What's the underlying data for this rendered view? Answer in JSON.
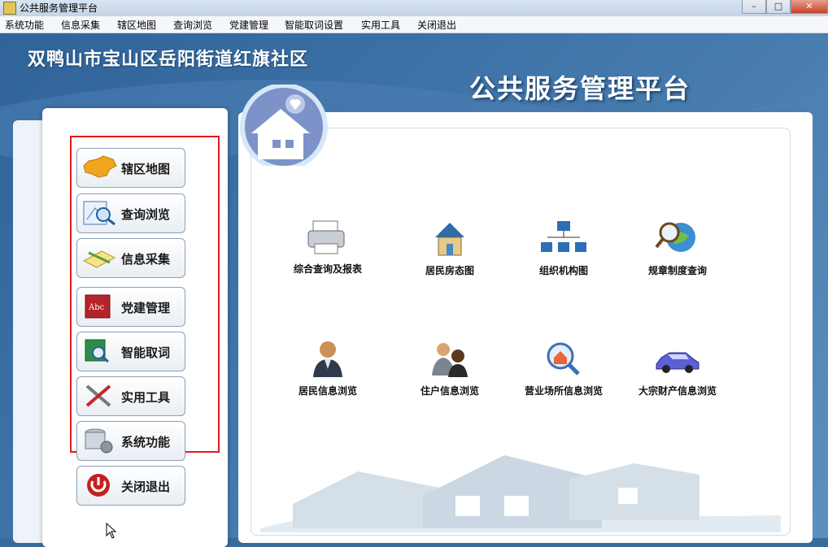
{
  "window": {
    "title": "公共服务管理平台",
    "buttons": [
      "–",
      "□",
      "✕"
    ]
  },
  "menu": [
    "系统功能",
    "信息采集",
    "辖区地图",
    "查询浏览",
    "党建管理",
    "智能取词设置",
    "实用工具",
    "关闭退出"
  ],
  "header": {
    "org_name": "双鸭山市宝山区岳阳街道红旗社区",
    "platform_title": "公共服务管理平台"
  },
  "sidebar": {
    "items": [
      {
        "label": "辖区地图",
        "icon": "china-map-icon"
      },
      {
        "label": "查询浏览",
        "icon": "magnifier-map-icon"
      },
      {
        "label": "信息采集",
        "icon": "notebook-pencil-icon"
      },
      {
        "label": "党建管理",
        "icon": "abc-book-icon"
      },
      {
        "label": "智能取词",
        "icon": "book-search-icon"
      },
      {
        "label": "实用工具",
        "icon": "tools-icon"
      },
      {
        "label": "系统功能",
        "icon": "database-gear-icon"
      },
      {
        "label": "关闭退出",
        "icon": "power-icon"
      }
    ]
  },
  "functions": [
    {
      "label": "综合查询及报表",
      "icon": "printer-icon"
    },
    {
      "label": "居民房态图",
      "icon": "house-icon"
    },
    {
      "label": "组织机构图",
      "icon": "org-chart-icon"
    },
    {
      "label": "规章制度查询",
      "icon": "globe-magnifier-icon"
    },
    {
      "label": "居民信息浏览",
      "icon": "resident-person-icon"
    },
    {
      "label": "住户信息浏览",
      "icon": "household-people-icon"
    },
    {
      "label": "营业场所信息浏览",
      "icon": "house-magnifier-icon"
    },
    {
      "label": "大宗财产信息浏览",
      "icon": "car-icon"
    }
  ],
  "colors": {
    "highlight": "#e21b1b",
    "background": "#3a6a9c"
  }
}
